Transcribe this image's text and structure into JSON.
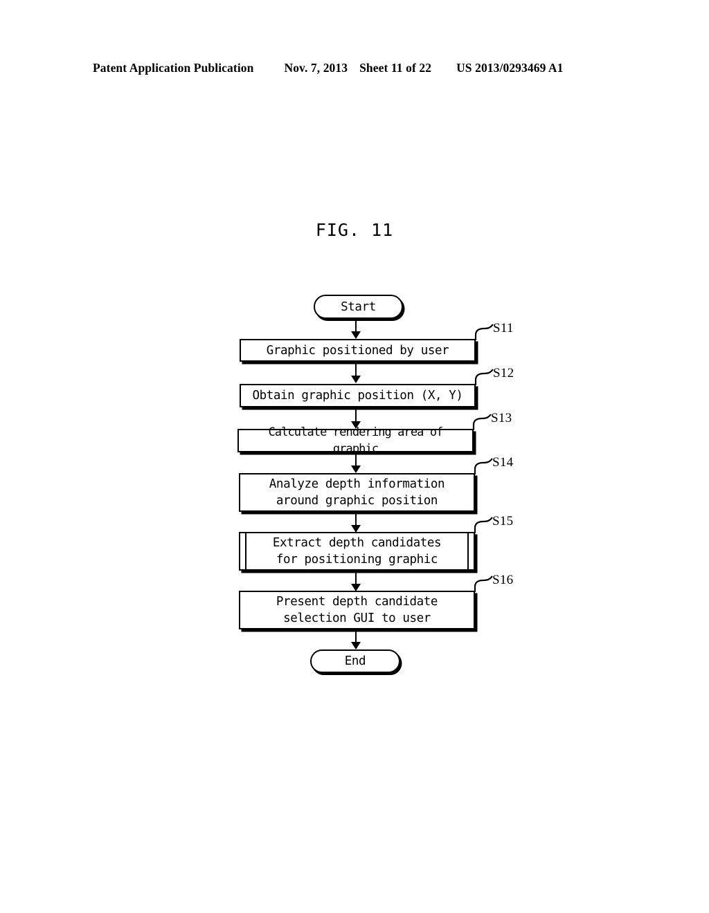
{
  "header": {
    "publication": "Patent Application Publication",
    "date": "Nov. 7, 2013",
    "sheet": "Sheet 11 of 22",
    "patent_number": "US 2013/0293469 A1"
  },
  "figure": {
    "title": "FIG. 11"
  },
  "flowchart": {
    "start_label": "Start",
    "end_label": "End",
    "steps": [
      {
        "id": "S11",
        "text": "Graphic positioned by user",
        "shape": "process"
      },
      {
        "id": "S12",
        "text": "Obtain graphic position (X, Y)",
        "shape": "process"
      },
      {
        "id": "S13",
        "text": "Calculate rendering area of graphic",
        "shape": "process"
      },
      {
        "id": "S14",
        "text": "Analyze depth information\naround graphic position",
        "shape": "process"
      },
      {
        "id": "S15",
        "text": "Extract depth candidates\nfor positioning graphic",
        "shape": "predefined-process"
      },
      {
        "id": "S16",
        "text": "Present depth candidate\nselection GUI to user",
        "shape": "process"
      }
    ]
  },
  "colors": {
    "ink": "#000000",
    "paper": "#ffffff"
  }
}
